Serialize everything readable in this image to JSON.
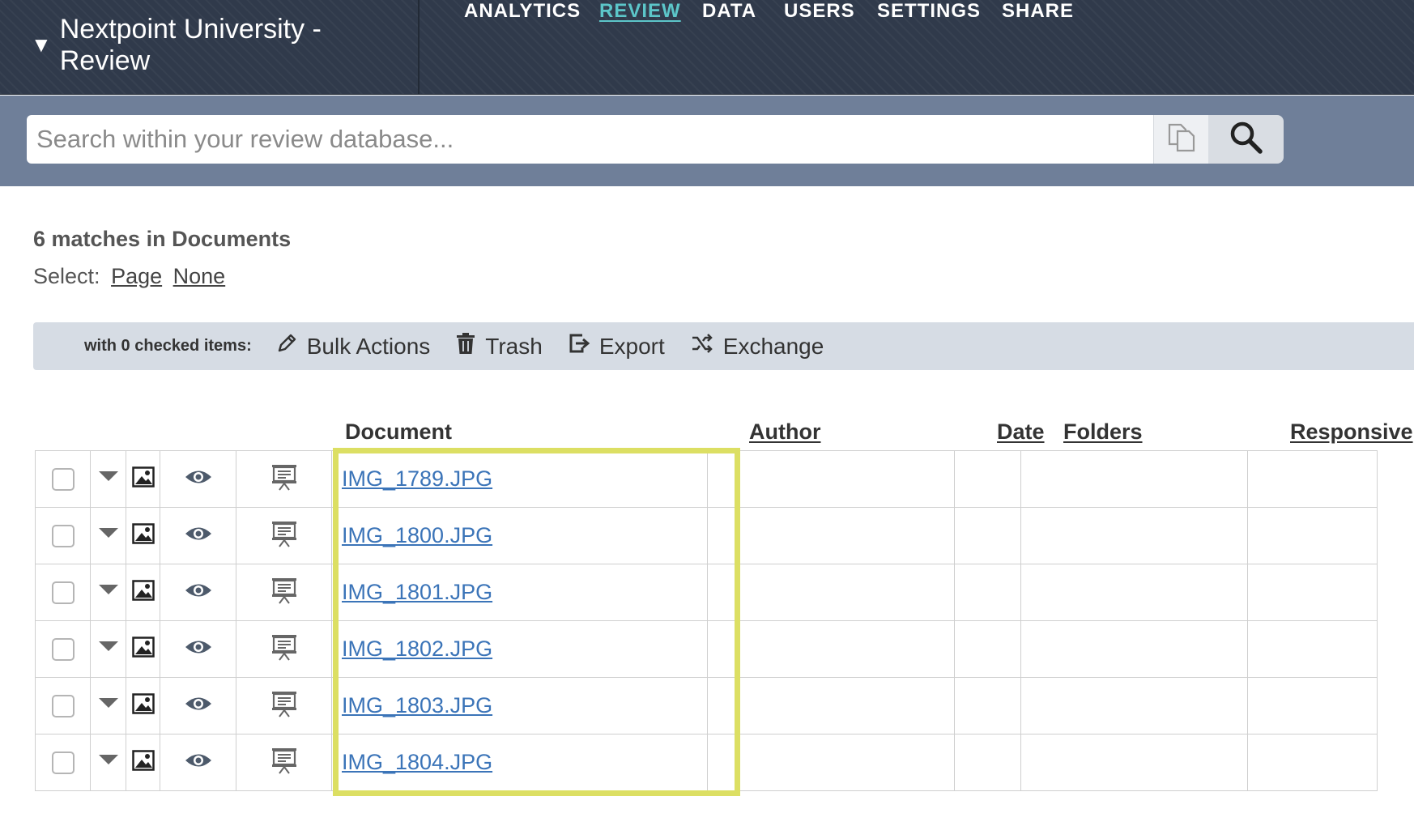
{
  "app": {
    "title": "Nextpoint University - Review",
    "caret": "▼"
  },
  "nav": {
    "items": [
      {
        "label": "ANALYTICS"
      },
      {
        "label": "REVIEW",
        "active": true
      },
      {
        "label": "DATA"
      },
      {
        "label": "USERS"
      },
      {
        "label": "SETTINGS"
      },
      {
        "label": "SHARE"
      }
    ],
    "active_color": "#5cc6c9"
  },
  "search": {
    "placeholder": "Search within your review database...",
    "value": ""
  },
  "results": {
    "summary": "6 matches in Documents",
    "select_label": "Select:",
    "select_page": "Page",
    "select_none": "None"
  },
  "bulkbar": {
    "label": "with 0 checked items:",
    "bulk_actions": "Bulk Actions",
    "trash": "Trash",
    "export": "Export",
    "exchange": "Exchange"
  },
  "table": {
    "columns": {
      "document": "Document",
      "author": "Author",
      "date": "Date",
      "folders": "Folders",
      "responsive": "Responsive"
    },
    "rows": [
      {
        "document": "IMG_1789.JPG"
      },
      {
        "document": "IMG_1800.JPG"
      },
      {
        "document": "IMG_1801.JPG"
      },
      {
        "document": "IMG_1802.JPG"
      },
      {
        "document": "IMG_1803.JPG"
      },
      {
        "document": "IMG_1804.JPG"
      }
    ],
    "row_icons": [
      "checkbox",
      "dropdown-caret-icon",
      "image-icon",
      "eye-icon",
      "presentation-icon"
    ]
  },
  "colors": {
    "topbar": "#303a4b",
    "searchband": "#6f7f99",
    "bulkbar": "#d6dce4",
    "link": "#3b74b8",
    "highlight": "#dcdf63"
  }
}
